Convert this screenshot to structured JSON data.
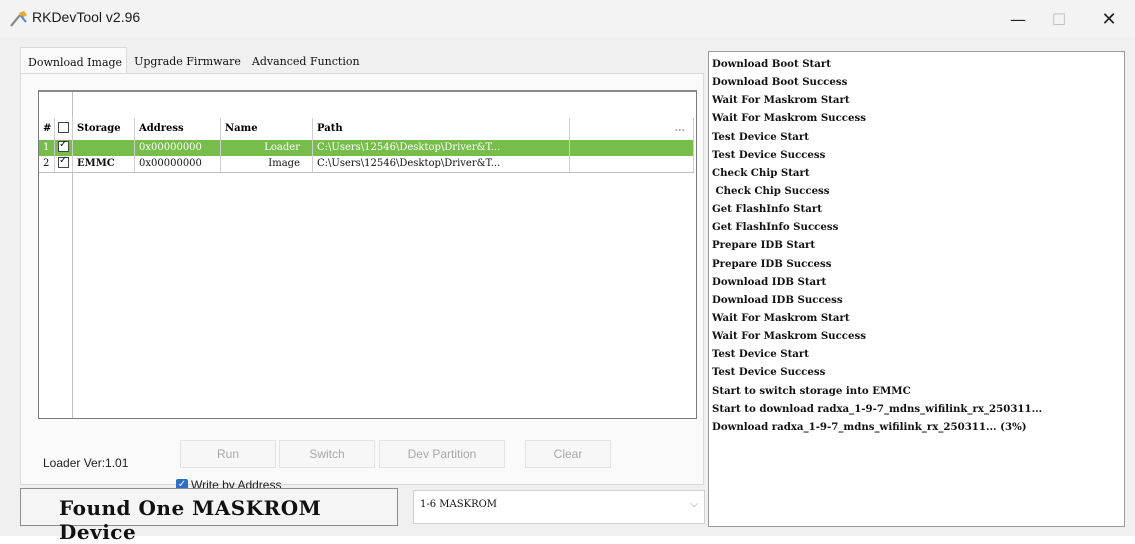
{
  "window": {
    "title": "RKDevTool v2.96",
    "controls": {
      "minimize": "—",
      "maximize": "☐",
      "close": "✕"
    }
  },
  "tabs": [
    {
      "label": "Download Image",
      "active": true
    },
    {
      "label": "Upgrade Firmware",
      "active": false
    },
    {
      "label": "Advanced Function",
      "active": false
    }
  ],
  "table": {
    "headers": {
      "num": "#",
      "check": "",
      "storage": "Storage",
      "address": "Address",
      "name": "Name",
      "path": "Path",
      "more": "..."
    },
    "rows": [
      {
        "num": "1",
        "checked": true,
        "storage": "",
        "address": "0x00000000",
        "name": "Loader",
        "path": "C:\\Users\\12546\\Desktop\\Driver&T...",
        "selected": true
      },
      {
        "num": "2",
        "checked": true,
        "storage": "EMMC",
        "address": "0x00000000",
        "name": "Image",
        "path": "C:\\Users\\12546\\Desktop\\Driver&T...",
        "selected": false
      }
    ]
  },
  "loader_version": "Loader Ver:1.01",
  "buttons": {
    "run": "Run",
    "switch": "Switch",
    "dev_partition": "Dev Partition",
    "clear": "Clear"
  },
  "write_by_address": {
    "label": "Write by Address",
    "checked": true
  },
  "status": "Found One MASKROM Device",
  "device_select": {
    "value": "1-6 MASKROM"
  },
  "log_lines": [
    "Download Boot Start",
    "Download Boot Success",
    "Wait For Maskrom Start",
    "Wait For Maskrom Success",
    "Test Device Start",
    "Test Device Success",
    "Check Chip Start",
    " Check Chip Success",
    "Get FlashInfo Start",
    "Get FlashInfo Success",
    "Prepare IDB Start",
    "Prepare IDB Success",
    "Download IDB Start",
    "Download IDB Success",
    "Wait For Maskrom Start",
    "Wait For Maskrom Success",
    "Test Device Start",
    "Test Device Success",
    "Start to switch storage into EMMC",
    "Start to download radxa_1-9-7_mdns_wifilink_rx_250311...",
    "Download radxa_1-9-7_mdns_wifilink_rx_250311... (3%)"
  ],
  "colors": {
    "selected_row": "#77bd4b",
    "checkbox_accent": "#2d6fc6"
  }
}
